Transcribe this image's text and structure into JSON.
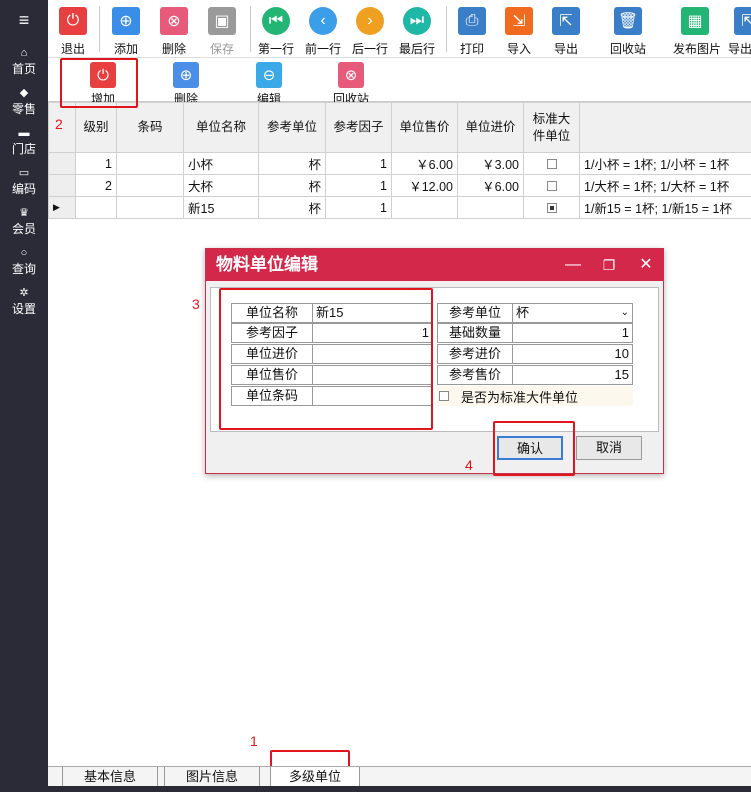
{
  "sidebar": {
    "menu_icon": "hamburger-icon",
    "items": [
      {
        "label": "首页",
        "icon": "home-icon"
      },
      {
        "label": "零售",
        "icon": "tag-icon"
      },
      {
        "label": "门店",
        "icon": "store-icon"
      },
      {
        "label": "编码",
        "icon": "code-icon"
      },
      {
        "label": "会员",
        "icon": "crown-icon"
      },
      {
        "label": "查询",
        "icon": "search-icon"
      },
      {
        "label": "设置",
        "icon": "gear-icon"
      }
    ]
  },
  "toolbar": {
    "items": [
      {
        "label": "退出",
        "icon": "power-icon",
        "color": "#e84040"
      },
      {
        "label": "添加",
        "icon": "plus-circle-icon",
        "color": "#3b8ee8"
      },
      {
        "label": "删除",
        "icon": "x-circle-icon",
        "color": "#e85a7a"
      },
      {
        "label": "保存",
        "icon": "floppy-icon",
        "color": "#9a9a9a"
      },
      {
        "label": "第一行",
        "icon": "first-icon",
        "color": "#22b573"
      },
      {
        "label": "前一行",
        "icon": "prev-icon",
        "color": "#3b9ee8"
      },
      {
        "label": "后一行",
        "icon": "next-icon",
        "color": "#f0a020"
      },
      {
        "label": "最后行",
        "icon": "last-icon",
        "color": "#1fb8a6"
      },
      {
        "label": "打印",
        "icon": "print-icon",
        "color": "#3b7ec8"
      },
      {
        "label": "导入",
        "icon": "import-icon",
        "color": "#f06a20"
      },
      {
        "label": "导出",
        "icon": "export-icon",
        "color": "#3b7ec8"
      },
      {
        "label": "回收站",
        "icon": "trash-icon",
        "color": "#3b7ec8"
      },
      {
        "label": "发布图片",
        "icon": "image-icon",
        "color": "#22b573"
      },
      {
        "label": "导出",
        "icon": "export-icon",
        "color": "#3b7ec8"
      }
    ]
  },
  "subbar": {
    "items": [
      {
        "label": "增加",
        "icon": "power-icon",
        "color": "#e84040"
      },
      {
        "label": "删除",
        "icon": "plus-circle-icon",
        "color": "#4a8ee8"
      },
      {
        "label": "编辑",
        "icon": "minus-circle-icon",
        "color": "#3ba8e8"
      },
      {
        "label": "回收站",
        "icon": "x-circle-icon",
        "color": "#e85a7a"
      }
    ]
  },
  "grid": {
    "headers": [
      "级别",
      "条码",
      "单位名称",
      "参考单位",
      "参考因子",
      "单位售价",
      "单位进价",
      "标准大件单位",
      ""
    ],
    "rows": [
      {
        "level": "1",
        "barcode": "",
        "name": "小杯",
        "ref_unit": "杯",
        "factor": "1",
        "sale": "￥6.00",
        "cost": "￥3.00",
        "std": false,
        "desc": "1/小杯 = 1杯;  1/小杯 = 1杯"
      },
      {
        "level": "2",
        "barcode": "",
        "name": "大杯",
        "ref_unit": "杯",
        "factor": "1",
        "sale": "￥12.00",
        "cost": "￥6.00",
        "std": false,
        "desc": "1/大杯 = 1杯;  1/大杯 = 1杯"
      },
      {
        "level": "",
        "barcode": "",
        "name": "新15",
        "ref_unit": "杯",
        "factor": "1",
        "sale": "",
        "cost": "",
        "std": true,
        "desc": "1/新15 = 1杯;  1/新15 = 1杯"
      }
    ]
  },
  "dialog": {
    "title": "物料单位编辑",
    "left": [
      {
        "key": "单位名称",
        "value": "新15"
      },
      {
        "key": "参考因子",
        "value": "1"
      },
      {
        "key": "单位进价",
        "value": ""
      },
      {
        "key": "单位售价",
        "value": ""
      },
      {
        "key": "单位条码",
        "value": ""
      }
    ],
    "right": [
      {
        "key": "参考单位",
        "value": "杯"
      },
      {
        "key": "基础数量",
        "value": "1"
      },
      {
        "key": "参考进价",
        "value": "10"
      },
      {
        "key": "参考售价",
        "value": "15"
      }
    ],
    "std_checkbox_label": "是否为标准大件单位",
    "ok": "确认",
    "cancel": "取消"
  },
  "annotations": {
    "n1": "1",
    "n2": "2",
    "n3": "3",
    "n4": "4"
  },
  "tabs": [
    "基本信息",
    "图片信息",
    "多级单位"
  ]
}
